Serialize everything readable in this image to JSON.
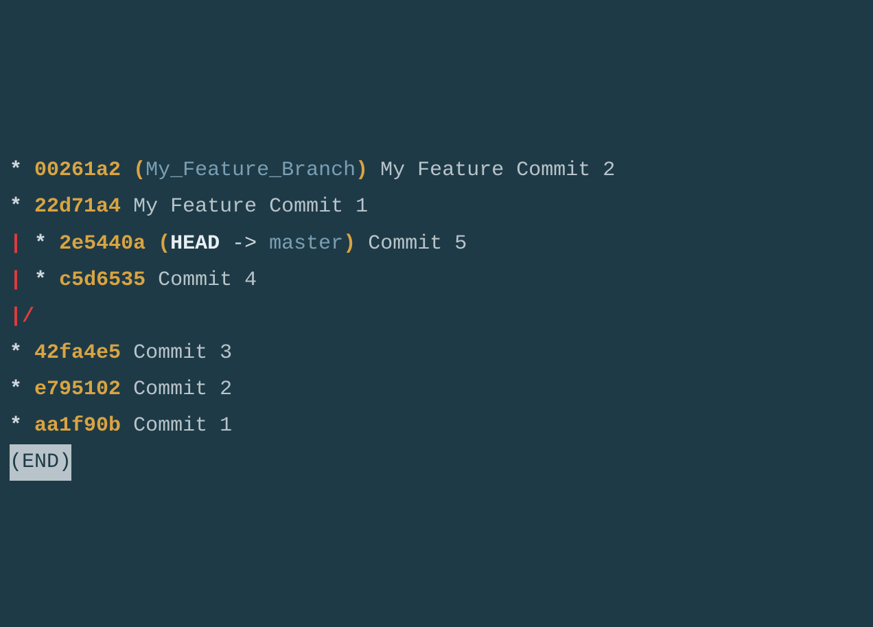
{
  "colors": {
    "bg": "#1e3a47",
    "hash": "#d9a441",
    "ref": "#7a9fb3",
    "pipe": "#e23c3c",
    "text": "#b8c4c9",
    "star": "#d0d8dd"
  },
  "lines": [
    {
      "graph_star": "*",
      "hash": "00261a2",
      "paren_open": "(",
      "ref_branch": "My_Feature_Branch",
      "paren_close": ")",
      "msg": " My Feature Commit 2"
    },
    {
      "graph_star": "*",
      "hash": "22d71a4",
      "msg": " My Feature Commit 1"
    },
    {
      "graph_pipe": "|",
      "graph_star": "*",
      "hash": "2e5440a",
      "paren_open": "(",
      "ref_head": "HEAD",
      "ref_arrow": " -> ",
      "ref_master": "master",
      "paren_close": ")",
      "msg": " Commit 5"
    },
    {
      "graph_pipe": "|",
      "graph_star": "*",
      "hash": "c5d6535",
      "msg": " Commit 4"
    },
    {
      "graph_pipe": "|",
      "graph_slash": "/"
    },
    {
      "graph_star": "*",
      "hash": "42fa4e5",
      "msg": " Commit 3"
    },
    {
      "graph_star": "*",
      "hash": "e795102",
      "msg": " Commit 2"
    },
    {
      "graph_star": "*",
      "hash": "aa1f90b",
      "msg": " Commit 1"
    }
  ],
  "end_marker": "(END)"
}
